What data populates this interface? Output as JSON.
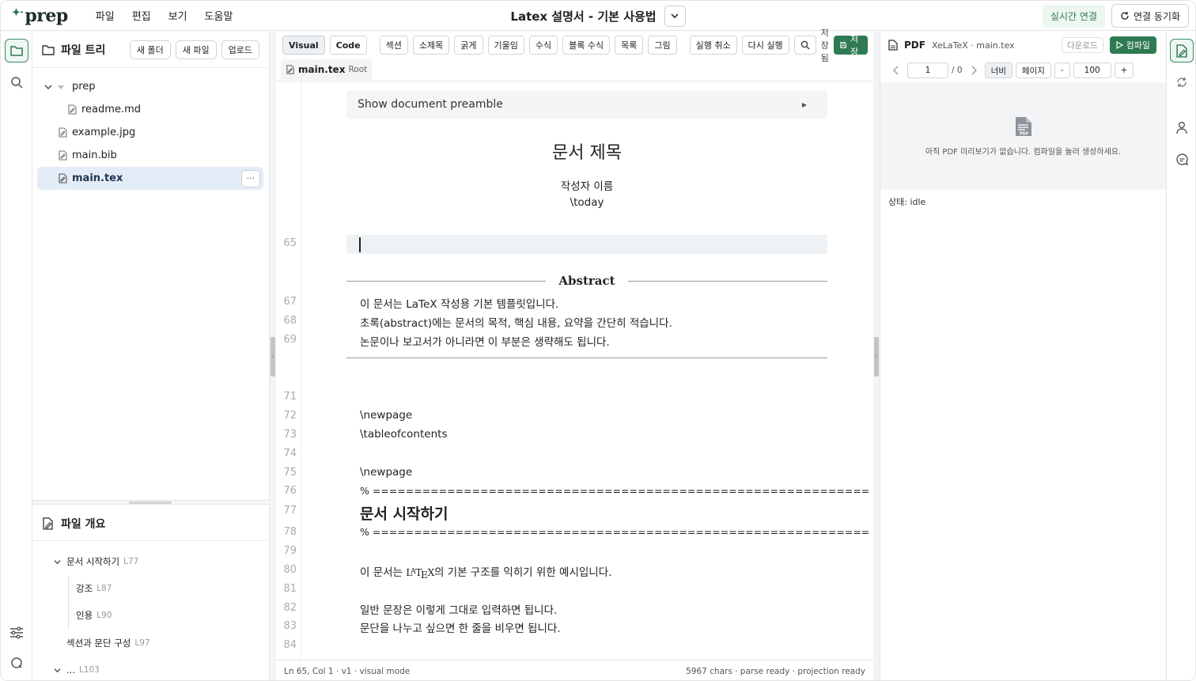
{
  "app": {
    "logo": "prep",
    "title": "Latex 설명서 - 기본 사용법"
  },
  "menu": [
    "파일",
    "편집",
    "보기",
    "도움말"
  ],
  "top_right": {
    "live": "실시간 연결",
    "sync": "연결 동기화"
  },
  "file_panel": {
    "title": "파일 트리",
    "buttons": [
      "새 폴더",
      "새 파일",
      "업로드"
    ],
    "tree": [
      {
        "name": "prep",
        "type": "folder"
      },
      {
        "name": "readme.md",
        "type": "file"
      },
      {
        "name": "example.jpg",
        "type": "file"
      },
      {
        "name": "main.bib",
        "type": "file"
      },
      {
        "name": "main.tex",
        "type": "file",
        "selected": true
      }
    ],
    "more": "···"
  },
  "outline": {
    "title": "파일 개요",
    "items": [
      {
        "label": "문서 시작하기",
        "line": "L77"
      },
      {
        "label": "강조",
        "line": "L87"
      },
      {
        "label": "인용",
        "line": "L90"
      },
      {
        "label": "섹션과 문단 구성",
        "line": "L97"
      },
      {
        "label": "...",
        "line": "L103"
      }
    ]
  },
  "toolbar": {
    "modes": [
      "Visual",
      "Code"
    ],
    "tools": [
      "섹션",
      "소제목",
      "굵게",
      "기울임",
      "수식",
      "블록 수식",
      "목록",
      "그림"
    ],
    "history": [
      "실행 취소",
      "다시 실행"
    ],
    "saved_label": "저장됨",
    "save_label": "저장"
  },
  "tab": {
    "name": "main.tex",
    "badge": "Root"
  },
  "document": {
    "preamble": "Show document preamble",
    "title": "문서 제목",
    "author": "작성자 이름",
    "date": "\\today",
    "abstract_label": "Abstract",
    "abstract_lines": [
      "이 문서는 LaTeX 작성용 기본 템플릿입니다.",
      "초록(abstract)에는 문서의 목적, 핵심 내용, 요약을 간단히 적습니다.",
      "논문이나 보고서가 아니라면 이 부분은 생략해도 됩니다."
    ],
    "lines": {
      "newpage1": "\\newpage",
      "toc": "\\tableofcontents",
      "newpage2": "\\newpage",
      "rule": "% ============================================================",
      "heading": "문서 시작하기",
      "intro_pre": "이 문서는 ",
      "intro_post": "의 기본 구조를 익히기 위한 예시입니다.",
      "p1": "일반 문장은 이렇게 그대로 입력하면 됩니다.",
      "p2": "문단을 나누고 싶으면 한 줄을 비우면 됩니다."
    },
    "line_numbers": [
      "65",
      "67",
      "68",
      "69",
      "71",
      "72",
      "73",
      "74",
      "75",
      "76",
      "77",
      "78",
      "79",
      "80",
      "81",
      "82",
      "83",
      "84"
    ]
  },
  "status": {
    "left": "Ln 65, Col 1 · v1 · visual mode",
    "right": "5967 chars · parse ready · projection ready"
  },
  "pdf": {
    "label": "PDF",
    "engine": "XeLaTeX · main.tex",
    "download": "다운로드",
    "compile": "컴파일",
    "page": "1",
    "total": "/ 0",
    "fit_width": "너비",
    "fit_page": "페이지",
    "zoom_out": "-",
    "zoom": "100",
    "zoom_in": "+",
    "empty": "아직 PDF 미리보기가 없습니다. 컴파일을 눌러 생성하세요.",
    "status": "상태: idle"
  },
  "colors": {
    "accent": "#2f7a52",
    "selection": "#e4edf7"
  }
}
